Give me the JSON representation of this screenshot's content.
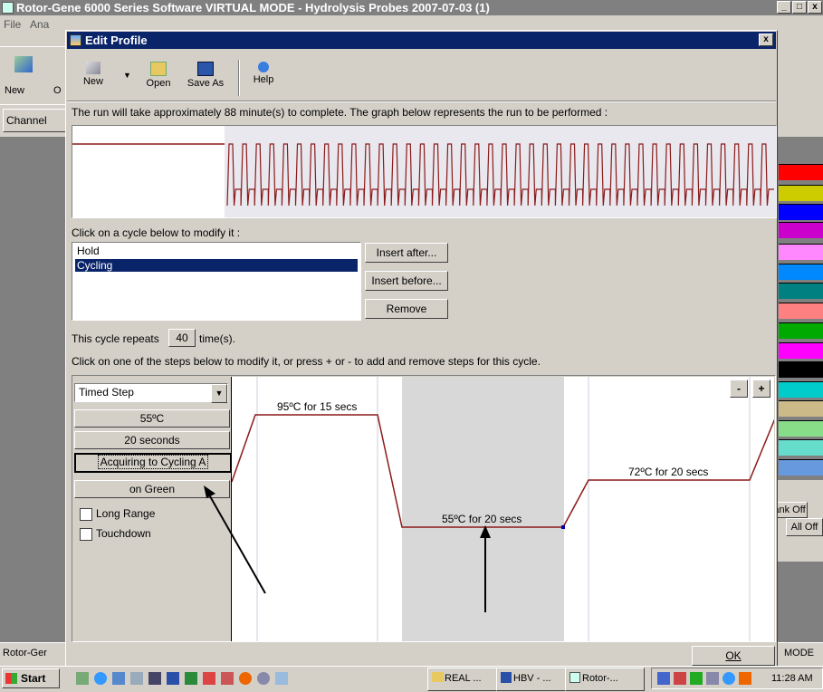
{
  "main_window": {
    "title": "Rotor-Gene 6000 Series Software VIRTUAL MODE - Hydrolysis Probes 2007-07-03 (1)",
    "menu": [
      "File",
      "Ana"
    ],
    "toolbar_new": "New",
    "toolbar_open_partial": "O",
    "tab_partial": "Channel",
    "status_left": "Rotor-Ger",
    "status_right": "MODE",
    "right_panel_labels": [
      "ank Off",
      "All Off"
    ],
    "win_controls": [
      "_",
      "□",
      "x"
    ]
  },
  "dialog": {
    "title": "Edit Profile",
    "close": "x",
    "toolbar": {
      "new": "New",
      "open": "Open",
      "save_as": "Save As",
      "help": "Help"
    },
    "run_info": "The run will take approximately 88 minute(s) to complete. The graph below represents the run to be performed :",
    "cycle_prompt": "Click on a cycle below to modify it :",
    "cycles": [
      "Hold",
      "Cycling"
    ],
    "selected_cycle": "Cycling",
    "insert_after": "Insert after...",
    "insert_before": "Insert before...",
    "remove": "Remove",
    "repeats_prefix": "This cycle repeats",
    "repeats_value": "40",
    "repeats_suffix": "time(s).",
    "steps_prompt": "Click on one of the steps below to modify it, or press + or - to add and remove steps for this cycle.",
    "step_type": "Timed Step",
    "step_temp": "55ºC",
    "step_time": "20 seconds",
    "acquiring": "Acquiring to Cycling A",
    "on_channel": "on Green",
    "long_range": "Long Range",
    "touchdown": "Touchdown",
    "minus": "-",
    "plus": "+",
    "ok": "OK",
    "step_labels": [
      "95ºC for 15 secs",
      "55ºC for 20 secs",
      "72ºC for 20 secs"
    ]
  },
  "colors": {
    "title_active": "#0a246a",
    "profile_line": "#8b1a1a",
    "swatches": [
      "#ff0000",
      "#cccc00",
      "#0000ff",
      "#cc00cc",
      "#ff88ff",
      "#0088ff",
      "#008080",
      "#ff8080",
      "#00aa00",
      "#ff00ff",
      "#000000",
      "#00cccc",
      "#ccbb88",
      "#88dd88",
      "#66ddcc",
      "#6699dd"
    ]
  },
  "taskbar": {
    "start": "Start",
    "tasks": [
      "REAL ...",
      "HBV - ...",
      "Rotor-..."
    ],
    "clock": "11:28 AM"
  }
}
